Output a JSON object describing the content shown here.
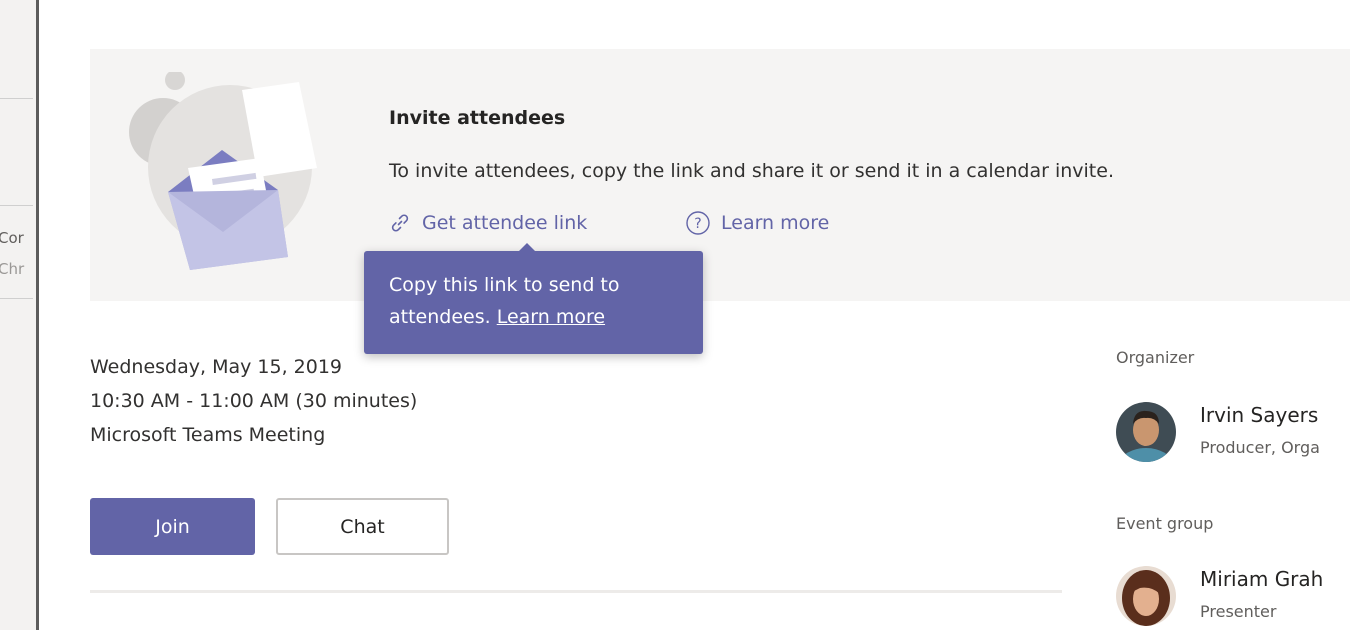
{
  "left_rail": {
    "fragment_1": "Cor",
    "fragment_2": "Chr"
  },
  "invite": {
    "title": "Invite attendees",
    "description": "To invite attendees, copy the link and share it or send it in a calendar invite.",
    "get_link_label": "Get attendee link",
    "learn_more_label": "Learn more"
  },
  "tooltip": {
    "line1": "Copy this link to send to",
    "line2_text": "attendees.",
    "line2_link": "Learn more"
  },
  "meeting": {
    "date": "Wednesday, May 15, 2019",
    "time": "10:30 AM - 11:00 AM (30 minutes)",
    "type": "Microsoft Teams Meeting"
  },
  "actions": {
    "join_label": "Join",
    "chat_label": "Chat"
  },
  "organizer": {
    "section_label": "Organizer",
    "name": "Irvin Sayers",
    "role": "Producer, Orga"
  },
  "event_group": {
    "section_label": "Event group",
    "name": "Miriam Grah",
    "role": "Presenter"
  },
  "colors": {
    "accent": "#6264a7",
    "banner_bg": "#f5f4f3",
    "text": "#252423"
  }
}
